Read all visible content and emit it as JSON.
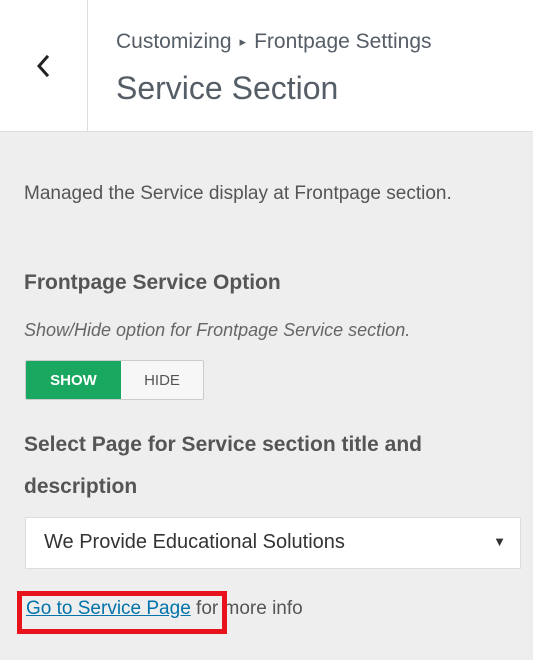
{
  "header": {
    "breadcrumb_root": "Customizing",
    "breadcrumb_separator": "▸",
    "breadcrumb_parent": "Frontpage Settings",
    "title": "Service Section",
    "back_icon": "chevron-left-icon"
  },
  "section": {
    "description": "Managed the Service display at Frontpage section."
  },
  "service_option": {
    "title": "Frontpage Service Option",
    "description": "Show/Hide option for Frontpage Service section.",
    "show_label": "SHOW",
    "hide_label": "HIDE",
    "selected": "SHOW"
  },
  "page_select": {
    "label": "Select Page for Service section title and description",
    "selected_value": "We Provide Educational Solutions",
    "arrow_icon": "caret-down-icon"
  },
  "info": {
    "link_text": "Go to Service Page",
    "suffix_text": " for more info"
  },
  "colors": {
    "accent_green": "#1aa760",
    "link_blue": "#0073aa",
    "highlight_red": "#e8121c"
  }
}
